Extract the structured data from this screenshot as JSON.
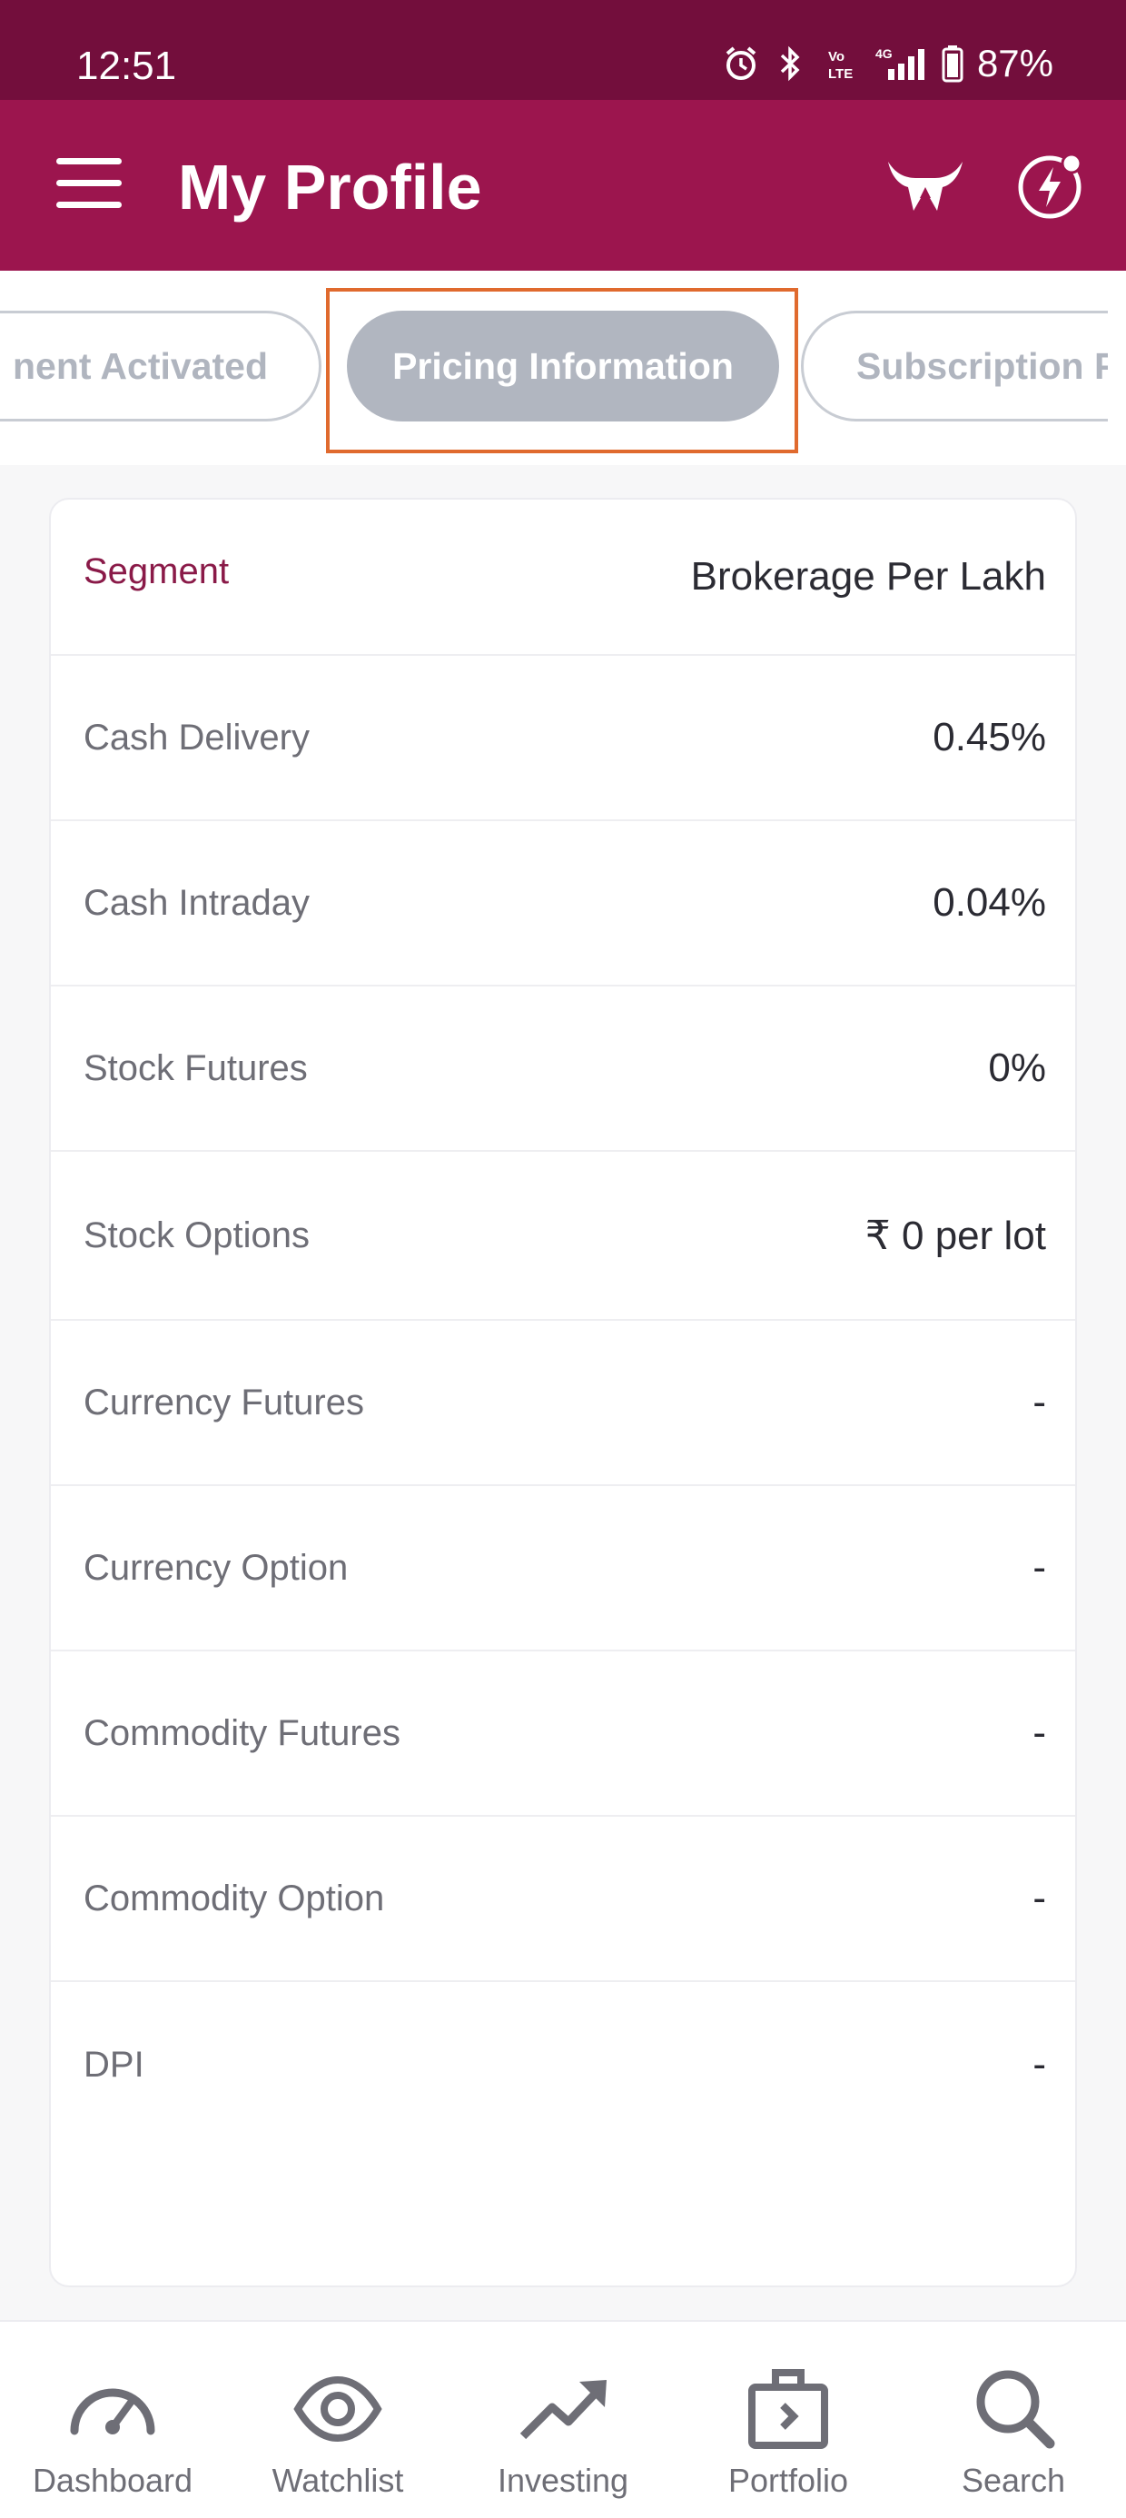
{
  "status_bar": {
    "time": "12:51",
    "battery": "87%",
    "icons": [
      "alarm-icon",
      "bluetooth-icon",
      "volte-icon",
      "4g-signal-icon",
      "battery-icon"
    ]
  },
  "header": {
    "title": "My Profile",
    "icons": [
      "menu-icon",
      "bull-logo-icon",
      "flash-icon"
    ]
  },
  "tabs": [
    {
      "label": "nent Activated",
      "active": false
    },
    {
      "label": "Pricing Information",
      "active": true
    },
    {
      "label": "Subscription P",
      "active": false
    }
  ],
  "pricing": {
    "header_label": "Segment",
    "header_value": "Brokerage Per Lakh",
    "rows": [
      {
        "label": "Cash Delivery",
        "value": "0.45%"
      },
      {
        "label": "Cash Intraday",
        "value": "0.04%"
      },
      {
        "label": "Stock Futures",
        "value": "0%"
      },
      {
        "label": "Stock Options",
        "value": "₹ 0 per lot"
      },
      {
        "label": "Currency Futures",
        "value": "-"
      },
      {
        "label": "Currency Option",
        "value": "-"
      },
      {
        "label": "Commodity Futures",
        "value": "-"
      },
      {
        "label": "Commodity Option",
        "value": "-"
      },
      {
        "label": "DPI",
        "value": "-"
      }
    ]
  },
  "bottom_nav": [
    {
      "label": "Dashboard",
      "icon": "speedometer-icon"
    },
    {
      "label": "Watchlist",
      "icon": "eye-icon"
    },
    {
      "label": "Investing",
      "icon": "trending-up-icon"
    },
    {
      "label": "Portfolio",
      "icon": "briefcase-icon"
    },
    {
      "label": "Search",
      "icon": "search-icon"
    }
  ],
  "colors": {
    "status_bar": "#730e3c",
    "app_bar": "#9c154e",
    "active_tab": "#b1b6c0",
    "segment_label": "#8a1a48",
    "highlight": "#e06a2e"
  }
}
